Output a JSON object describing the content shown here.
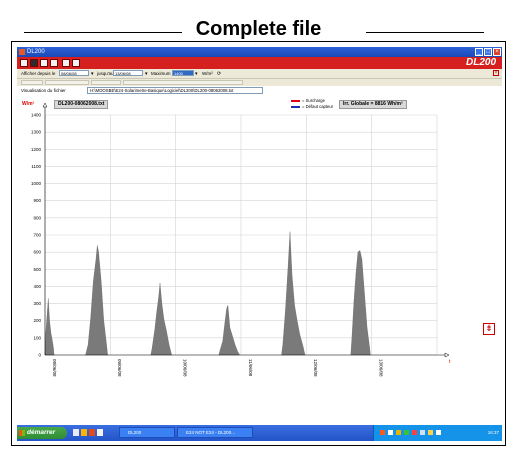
{
  "caption": "Complete file",
  "window": {
    "title": "DL200",
    "brand": "DL200"
  },
  "filter": {
    "from_label": "Afficher depuis le",
    "from_value": "08/06/08",
    "to_label": "jusqu'au",
    "to_value": "13/06/08",
    "max_label": "Maximum",
    "max_value": "1400",
    "unit": "W/m²"
  },
  "file": {
    "label": "Visualisation du fichier",
    "path": "H:\\MOOSBE\\E24-Solarimetre-Basique\\Logiciel\\DL200\\DL200-08062008.txt"
  },
  "chart_data": {
    "type": "area",
    "ylabel": "W/m²",
    "file_label": "DL200-08062008.txt",
    "global_label": "Irr. Globale = 8816 Wh/m²",
    "legend": [
      {
        "name": "= Surcharge",
        "color": "#e0001a"
      },
      {
        "name": "= Défaut capteur",
        "color": "#1c2fb0"
      }
    ],
    "ylim": [
      0,
      1400
    ],
    "y_ticks": [
      0,
      100,
      200,
      300,
      400,
      500,
      600,
      700,
      800,
      900,
      1000,
      1100,
      1200,
      1300,
      1400
    ],
    "x_ticks": [
      "08/06/08",
      "09/06/08",
      "10/06/08",
      "11/06/08",
      "12/06/08",
      "13/06/08"
    ],
    "x_end_label": "t",
    "fill_color": "#7a7a7a",
    "days": [
      {
        "start": 0.0,
        "end": 0.14,
        "peaks": [
          [
            0.01,
            120
          ],
          [
            0.03,
            230
          ],
          [
            0.05,
            330
          ],
          [
            0.07,
            200
          ],
          [
            0.09,
            130
          ],
          [
            0.11,
            90
          ],
          [
            0.13,
            40
          ]
        ]
      },
      {
        "start": 0.62,
        "end": 0.96,
        "peaks": [
          [
            0.66,
            60
          ],
          [
            0.7,
            220
          ],
          [
            0.74,
            430
          ],
          [
            0.78,
            560
          ],
          [
            0.8,
            640
          ],
          [
            0.82,
            600
          ],
          [
            0.86,
            430
          ],
          [
            0.9,
            200
          ],
          [
            0.94,
            70
          ]
        ]
      },
      {
        "start": 1.62,
        "end": 1.94,
        "peaks": [
          [
            1.64,
            40
          ],
          [
            1.68,
            150
          ],
          [
            1.71,
            250
          ],
          [
            1.74,
            340
          ],
          [
            1.76,
            420
          ],
          [
            1.79,
            300
          ],
          [
            1.82,
            210
          ],
          [
            1.86,
            140
          ],
          [
            1.9,
            60
          ]
        ]
      },
      {
        "start": 2.66,
        "end": 2.98,
        "peaks": [
          [
            2.68,
            30
          ],
          [
            2.72,
            80
          ],
          [
            2.75,
            180
          ],
          [
            2.78,
            270
          ],
          [
            2.8,
            290
          ],
          [
            2.83,
            160
          ],
          [
            2.87,
            110
          ],
          [
            2.91,
            60
          ],
          [
            2.95,
            20
          ]
        ]
      },
      {
        "start": 3.62,
        "end": 3.98,
        "peaks": [
          [
            3.64,
            60
          ],
          [
            3.68,
            260
          ],
          [
            3.72,
            510
          ],
          [
            3.75,
            720
          ],
          [
            3.78,
            470
          ],
          [
            3.82,
            290
          ],
          [
            3.86,
            200
          ],
          [
            3.9,
            120
          ],
          [
            3.95,
            50
          ]
        ]
      },
      {
        "start": 4.68,
        "end": 4.98,
        "peaks": [
          [
            4.7,
            120
          ],
          [
            4.73,
            320
          ],
          [
            4.76,
            480
          ],
          [
            4.79,
            600
          ],
          [
            4.82,
            610
          ],
          [
            4.85,
            560
          ],
          [
            4.89,
            360
          ],
          [
            4.93,
            160
          ],
          [
            4.97,
            40
          ]
        ]
      }
    ]
  }
}
